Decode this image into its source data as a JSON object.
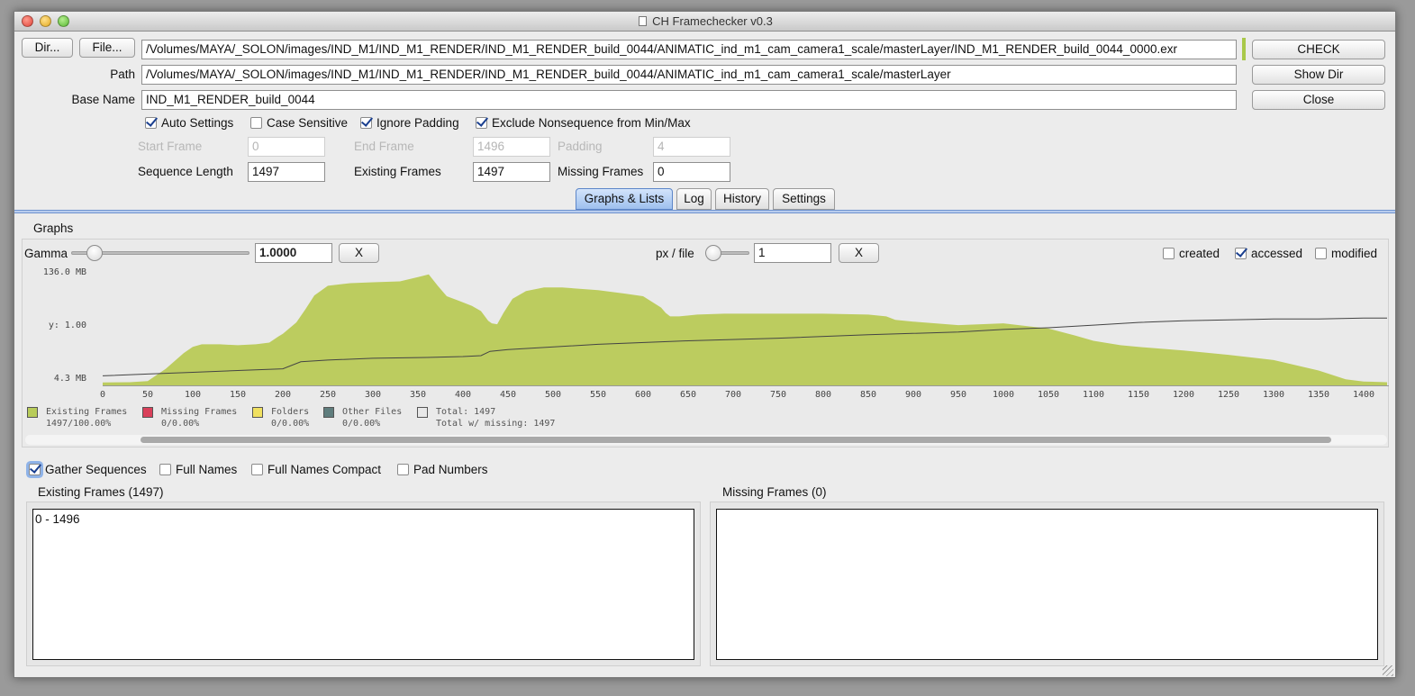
{
  "window": {
    "title": "CH Framechecker v0.3"
  },
  "toolbar": {
    "dir_label": "Dir...",
    "file_label": "File...",
    "file_path": "/Volumes/MAYA/_SOLON/images/IND_M1/IND_M1_RENDER/IND_M1_RENDER_build_0044/ANIMATIC_ind_m1_cam_camera1_scale/masterLayer/IND_M1_RENDER_build_0044_0000.exr",
    "check_label": "CHECK",
    "show_dir_label": "Show Dir",
    "close_label": "Close",
    "status_color": "#a9c84a"
  },
  "form": {
    "path_label": "Path",
    "path_value": "/Volumes/MAYA/_SOLON/images/IND_M1/IND_M1_RENDER/IND_M1_RENDER_build_0044/ANIMATIC_ind_m1_cam_camera1_scale/masterLayer",
    "base_name_label": "Base Name",
    "base_name_value": "IND_M1_RENDER_build_0044",
    "options": [
      {
        "label": "Auto Settings",
        "checked": true
      },
      {
        "label": "Case Sensitive",
        "checked": false
      },
      {
        "label": "Ignore Padding",
        "checked": true
      },
      {
        "label": "Exclude Nonsequence from Min/Max",
        "checked": true
      }
    ],
    "start_frame_label": "Start Frame",
    "start_frame_value": "0",
    "end_frame_label": "End Frame",
    "end_frame_value": "1496",
    "padding_label": "Padding",
    "padding_value": "4",
    "seq_length_label": "Sequence Length",
    "seq_length_value": "1497",
    "existing_frames_label": "Existing Frames",
    "existing_frames_value": "1497",
    "missing_frames_label": "Missing Frames",
    "missing_frames_value": "0"
  },
  "tabs": [
    {
      "label": "Graphs & Lists",
      "active": true
    },
    {
      "label": "Log",
      "active": false
    },
    {
      "label": "History",
      "active": false
    },
    {
      "label": "Settings",
      "active": false
    }
  ],
  "graphs": {
    "section_label": "Graphs",
    "gamma_label": "Gamma",
    "gamma_value": "1.0000",
    "gamma_reset_label": "X",
    "pxfile_label": "px / file",
    "pxfile_value": "1",
    "pxfile_reset_label": "X",
    "created_label": "created",
    "created_checked": false,
    "accessed_label": "accessed",
    "accessed_checked": true,
    "modified_label": "modified",
    "modified_checked": false
  },
  "legend": [
    {
      "name": "Existing Frames",
      "value": "1497/100.00%",
      "color": "#b8cc5a"
    },
    {
      "name": "Missing Frames",
      "value": "0/0.00%",
      "color": "#d9405a"
    },
    {
      "name": "Folders",
      "value": "0/0.00%",
      "color": "#f0e060"
    },
    {
      "name": "Other Files",
      "value": "0/0.00%",
      "color": "#5f7d7d"
    },
    {
      "name": "Total: 1497",
      "value": "Total w/ missing: 1497",
      "color": "#e8e8e8"
    }
  ],
  "chart_data": {
    "type": "area",
    "y_labels": [
      "136.0 MB",
      "y: 1.00",
      "4.3 MB"
    ],
    "xlim": [
      0,
      1426
    ],
    "x_ticks": [
      0,
      50,
      100,
      150,
      200,
      250,
      300,
      350,
      400,
      450,
      500,
      550,
      600,
      650,
      700,
      750,
      800,
      850,
      900,
      950,
      1000,
      1050,
      1100,
      1150,
      1200,
      1250,
      1300,
      1350,
      1400
    ],
    "series": [
      {
        "kind": "file size",
        "color": "#bccc5f",
        "x": [
          0,
          30,
          50,
          70,
          90,
          100,
          110,
          130,
          150,
          170,
          185,
          195,
          200,
          215,
          225,
          235,
          250,
          275,
          300,
          330,
          350,
          362,
          372,
          382,
          395,
          410,
          420,
          428,
          432,
          438,
          445,
          455,
          470,
          490,
          510,
          550,
          580,
          600,
          620,
          625,
          630,
          640,
          660,
          690,
          750,
          800,
          850,
          870,
          880,
          900,
          950,
          1000,
          1050,
          1080,
          1100,
          1130,
          1150,
          1200,
          1250,
          1300,
          1350,
          1380,
          1400,
          1426
        ],
        "y": [
          4.3,
          4.6,
          6,
          20,
          38,
          45,
          48,
          48,
          47,
          48,
          50,
          57,
          60,
          73,
          88,
          104,
          115,
          118,
          119,
          120,
          125,
          128,
          115,
          103,
          98,
          92,
          86,
          75,
          72,
          71,
          84,
          100,
          109,
          113,
          113,
          110,
          106,
          103,
          90,
          84,
          80,
          80,
          82,
          83,
          83,
          83,
          82,
          80,
          76,
          74,
          70,
          72,
          66,
          58,
          52,
          47,
          45,
          41,
          36,
          30,
          18,
          8,
          5.5,
          4.6
        ]
      },
      {
        "kind": "accessed",
        "color": "#444444",
        "x": [
          0,
          50,
          100,
          150,
          200,
          220,
          250,
          300,
          360,
          400,
          420,
          430,
          450,
          550,
          650,
          750,
          850,
          950,
          1000,
          1050,
          1100,
          1150,
          1200,
          1250,
          1300,
          1350,
          1400,
          1426
        ],
        "y": [
          12,
          14,
          16,
          18,
          20,
          28,
          30,
          32,
          33,
          34,
          35,
          40,
          42,
          48,
          52,
          55,
          59,
          62,
          65,
          67,
          70,
          73,
          75,
          76,
          77,
          77,
          78,
          78
        ]
      }
    ],
    "grid": false
  },
  "lists": {
    "gather_sequences_label": "Gather Sequences",
    "gather_sequences_checked": true,
    "full_names_label": "Full Names",
    "full_names_checked": false,
    "full_names_compact_label": "Full Names Compact",
    "full_names_compact_checked": false,
    "pad_numbers_label": "Pad Numbers",
    "pad_numbers_checked": false,
    "existing_title": "Existing Frames (1497)",
    "existing_items": [
      "0 - 1496"
    ],
    "missing_title": "Missing Frames (0)",
    "missing_items": []
  }
}
